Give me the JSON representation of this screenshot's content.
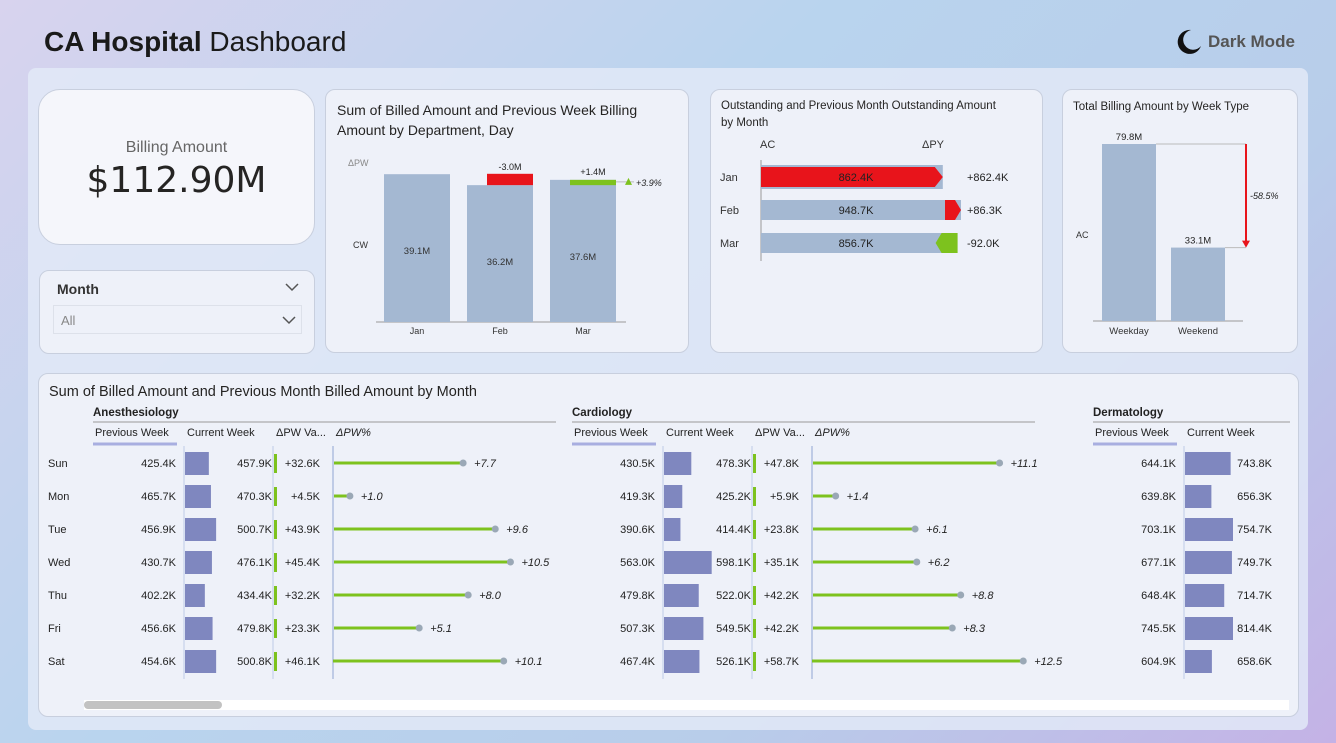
{
  "header": {
    "title_bold": "CA Hospital",
    "title_rest": "Dashboard",
    "dark_mode_label": "Dark Mode"
  },
  "kpi": {
    "label": "Billing Amount",
    "value": "$112.90M"
  },
  "slicer": {
    "header": "Month",
    "selected": "All"
  },
  "chart1": {
    "title_line1": "Sum of Billed Amount and Previous Week Billing",
    "title_line2": "Amount by Department, Day",
    "row_label_top": "ΔPW",
    "row_label_bottom": "CW",
    "delta_pct": "+3.9%"
  },
  "chart2": {
    "title_line1": "Outstanding and Previous Month Outstanding Amount",
    "title_line2": "by Month",
    "col_ac": "AC",
    "col_dpy": "ΔPY"
  },
  "chart3": {
    "title": "Total Billing Amount by Week Type",
    "row_label": "AC",
    "delta_pct": "-58.5%"
  },
  "table": {
    "title": "Sum of Billed Amount and Previous Month Billed Amount by Month",
    "col_labels": [
      "Previous Week",
      "Current Week",
      "ΔPW Va...",
      "ΔPW%"
    ],
    "days": [
      "Sun",
      "Mon",
      "Tue",
      "Wed",
      "Thu",
      "Fri",
      "Sat"
    ]
  },
  "chart_data": [
    {
      "type": "bar",
      "categories": [
        "Jan",
        "Feb",
        "Mar"
      ],
      "values": [
        39.1,
        36.2,
        37.6
      ],
      "value_labels": [
        "39.1M",
        "36.2M",
        "37.6M"
      ],
      "delta_labels": [
        "",
        "-3.0M",
        "+1.4M"
      ],
      "delta_values": [
        0,
        -3.0,
        1.4
      ],
      "delta_colors": [
        "",
        "#e8141b",
        "#7dc21e"
      ],
      "ylim": [
        0,
        41
      ]
    },
    {
      "type": "bar",
      "categories": [
        "Jan",
        "Feb",
        "Mar"
      ],
      "values": [
        862.4,
        948.7,
        856.7
      ],
      "value_labels": [
        "862.4K",
        "948.7K",
        "856.7K"
      ],
      "delta_labels": [
        "+862.4K",
        "+86.3K",
        "-92.0K"
      ],
      "delta_values": [
        862.4,
        86.3,
        -92.0
      ],
      "xlim": [
        0,
        948.7
      ]
    },
    {
      "type": "bar",
      "categories": [
        "Weekday",
        "Weekend"
      ],
      "values": [
        79.8,
        33.1
      ],
      "value_labels": [
        "79.8M",
        "33.1M"
      ],
      "ylim": [
        0,
        79.8
      ]
    },
    {
      "type": "table",
      "departments": [
        {
          "name": "Anesthesiology",
          "prev_labels": [
            "425.4K",
            "465.7K",
            "456.9K",
            "430.7K",
            "402.2K",
            "456.6K",
            "454.6K"
          ],
          "cur_labels": [
            "457.9K",
            "470.3K",
            "500.7K",
            "476.1K",
            "434.4K",
            "479.8K",
            "500.8K"
          ],
          "current": [
            457.9,
            470.3,
            500.7,
            476.1,
            434.4,
            479.8,
            500.8
          ],
          "dpw_labels": [
            "+32.6K",
            "+4.5K",
            "+43.9K",
            "+45.4K",
            "+32.2K",
            "+23.3K",
            "+46.1K"
          ],
          "dpw": [
            32.6,
            4.5,
            43.9,
            45.4,
            32.2,
            23.3,
            46.1
          ],
          "pct_labels": [
            "+7.7",
            "+1.0",
            "+9.6",
            "+10.5",
            "+8.0",
            "+5.1",
            "+10.1"
          ],
          "pct": [
            7.7,
            1.0,
            9.6,
            10.5,
            8.0,
            5.1,
            10.1
          ]
        },
        {
          "name": "Cardiology",
          "prev_labels": [
            "430.5K",
            "419.3K",
            "390.6K",
            "563.0K",
            "479.8K",
            "507.3K",
            "467.4K"
          ],
          "cur_labels": [
            "478.3K",
            "425.2K",
            "414.4K",
            "598.1K",
            "522.0K",
            "549.5K",
            "526.1K"
          ],
          "current": [
            478.3,
            425.2,
            414.4,
            598.1,
            522.0,
            549.5,
            526.1
          ],
          "dpw_labels": [
            "+47.8K",
            "+5.9K",
            "+23.8K",
            "+35.1K",
            "+42.2K",
            "+42.2K",
            "+58.7K"
          ],
          "dpw": [
            47.8,
            5.9,
            23.8,
            35.1,
            42.2,
            42.2,
            58.7
          ],
          "pct_labels": [
            "+11.1",
            "+1.4",
            "+6.1",
            "+6.2",
            "+8.8",
            "+8.3",
            "+12.5"
          ],
          "pct": [
            11.1,
            1.4,
            6.1,
            6.2,
            8.8,
            8.3,
            12.5
          ]
        },
        {
          "name": "Dermatology",
          "prev_labels": [
            "644.1K",
            "639.8K",
            "703.1K",
            "677.1K",
            "648.4K",
            "745.5K",
            "604.9K"
          ],
          "cur_labels": [
            "743.8K",
            "656.3K",
            "754.7K",
            "749.7K",
            "714.7K",
            "814.4K",
            "658.6K"
          ],
          "current": [
            743.8,
            656.3,
            754.7,
            749.7,
            714.7,
            814.4,
            658.6
          ],
          "dpw_labels": [],
          "dpw": [],
          "pct_labels": [],
          "pct": []
        }
      ]
    }
  ]
}
